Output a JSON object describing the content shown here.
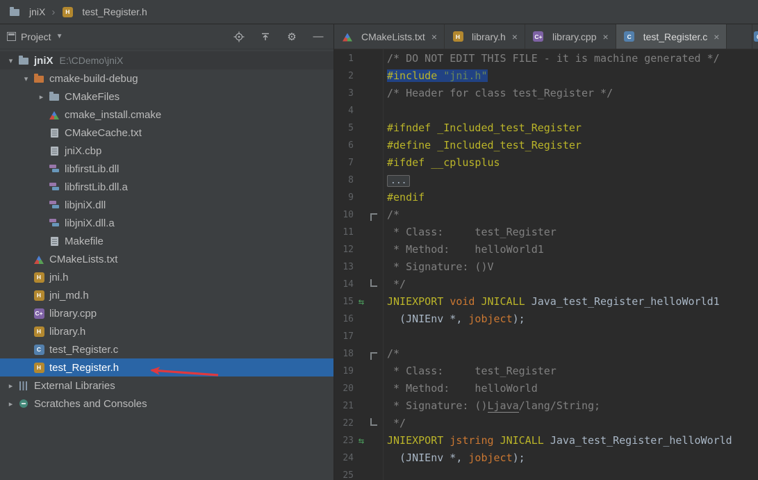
{
  "breadcrumb": {
    "root": "jniX",
    "file": "test_Register.h"
  },
  "project_panel": {
    "title": "Project",
    "toolbar_icons": [
      "locate",
      "collapse-all",
      "settings",
      "hide-panel"
    ],
    "tree": [
      {
        "label": "jniX",
        "suffix": "E:\\CDemo\\jniX",
        "level": 0,
        "icon": "folder",
        "arrow": "down",
        "bold": true,
        "root": true
      },
      {
        "label": "cmake-build-debug",
        "level": 1,
        "icon": "folder-excluded",
        "arrow": "down"
      },
      {
        "label": "CMakeFiles",
        "level": 2,
        "icon": "folder",
        "arrow": "right"
      },
      {
        "label": "cmake_install.cmake",
        "level": 2,
        "icon": "cmake"
      },
      {
        "label": "CMakeCache.txt",
        "level": 2,
        "icon": "doc"
      },
      {
        "label": "jniX.cbp",
        "level": 2,
        "icon": "doc"
      },
      {
        "label": "libfirstLib.dll",
        "level": 2,
        "icon": "lib"
      },
      {
        "label": "libfirstLib.dll.a",
        "level": 2,
        "icon": "lib"
      },
      {
        "label": "libjniX.dll",
        "level": 2,
        "icon": "lib"
      },
      {
        "label": "libjniX.dll.a",
        "level": 2,
        "icon": "lib"
      },
      {
        "label": "Makefile",
        "level": 2,
        "icon": "doc"
      },
      {
        "label": "CMakeLists.txt",
        "level": 1,
        "icon": "cmake"
      },
      {
        "label": "jni.h",
        "level": 1,
        "icon": "h"
      },
      {
        "label": "jni_md.h",
        "level": 1,
        "icon": "h"
      },
      {
        "label": "library.cpp",
        "level": 1,
        "icon": "cpp"
      },
      {
        "label": "library.h",
        "level": 1,
        "icon": "h"
      },
      {
        "label": "test_Register.c",
        "level": 1,
        "icon": "c"
      },
      {
        "label": "test_Register.h",
        "level": 1,
        "icon": "h",
        "selected": true
      },
      {
        "label": "External Libraries",
        "level": 0,
        "icon": "extlib",
        "arrow": "right"
      },
      {
        "label": "Scratches and Consoles",
        "level": 0,
        "icon": "scratch",
        "arrow": "right"
      }
    ]
  },
  "editor": {
    "tabs": [
      {
        "label": "CMakeLists.txt",
        "icon": "cmake",
        "active": false
      },
      {
        "label": "library.h",
        "icon": "h",
        "active": false
      },
      {
        "label": "library.cpp",
        "icon": "cpp",
        "active": false
      },
      {
        "label": "test_Register.c",
        "icon": "c",
        "active": true
      }
    ],
    "lines": [
      {
        "num": 1,
        "tokens": [
          {
            "t": "/* DO NOT EDIT THIS FILE - it is machine generated */",
            "c": "cm"
          }
        ]
      },
      {
        "num": 2,
        "selected": true,
        "tokens": [
          {
            "t": "#include ",
            "c": "pp"
          },
          {
            "t": "\"jni.h\"",
            "c": "str"
          }
        ]
      },
      {
        "num": 3,
        "tokens": [
          {
            "t": "/* Header for class test_Register */",
            "c": "cm"
          }
        ]
      },
      {
        "num": 4,
        "tokens": []
      },
      {
        "num": 5,
        "tokens": [
          {
            "t": "#ifndef _Included_test_Register",
            "c": "pp"
          }
        ]
      },
      {
        "num": 6,
        "tokens": [
          {
            "t": "#define _Included_test_Register",
            "c": "pp"
          }
        ]
      },
      {
        "num": 7,
        "tokens": [
          {
            "t": "#ifdef __cplusplus",
            "c": "pp"
          }
        ]
      },
      {
        "num": 8,
        "tokens": [
          {
            "t": "...",
            "c": "fold"
          }
        ]
      },
      {
        "num": 9,
        "tokens": [
          {
            "t": "#endif",
            "c": "pp"
          }
        ]
      },
      {
        "num": 10,
        "fold": "open",
        "tokens": [
          {
            "t": "/*",
            "c": "cm"
          }
        ]
      },
      {
        "num": 11,
        "tokens": [
          {
            "t": " * Class:     test_Register",
            "c": "cm"
          }
        ]
      },
      {
        "num": 12,
        "tokens": [
          {
            "t": " * Method:    helloWorld1",
            "c": "cm"
          }
        ]
      },
      {
        "num": 13,
        "tokens": [
          {
            "t": " * Signature: ()V",
            "c": "cm"
          }
        ]
      },
      {
        "num": 14,
        "fold": "close",
        "tokens": [
          {
            "t": " */",
            "c": "cm"
          }
        ]
      },
      {
        "num": 15,
        "gutter": "impl",
        "tokens": [
          {
            "t": "JNIEXPORT ",
            "c": "pp"
          },
          {
            "t": "void ",
            "c": "kw"
          },
          {
            "t": "JNICALL ",
            "c": "pp"
          },
          {
            "t": "Java_test_Register_helloWorld1",
            "c": "fn"
          }
        ]
      },
      {
        "num": 16,
        "tokens": [
          {
            "t": "  (JNIEnv *, ",
            "c": "pl"
          },
          {
            "t": "jobject",
            "c": "kw"
          },
          {
            "t": ");",
            "c": "pl"
          }
        ]
      },
      {
        "num": 17,
        "tokens": []
      },
      {
        "num": 18,
        "fold": "open",
        "tokens": [
          {
            "t": "/*",
            "c": "cm"
          }
        ]
      },
      {
        "num": 19,
        "tokens": [
          {
            "t": " * Class:     test_Register",
            "c": "cm"
          }
        ]
      },
      {
        "num": 20,
        "tokens": [
          {
            "t": " * Method:    helloWorld",
            "c": "cm"
          }
        ]
      },
      {
        "num": 21,
        "tokens": [
          {
            "t": " * Signature: ()",
            "c": "cm"
          },
          {
            "t": "Ljava",
            "c": "cm u"
          },
          {
            "t": "/lang/String;",
            "c": "cm"
          }
        ]
      },
      {
        "num": 22,
        "fold": "close",
        "tokens": [
          {
            "t": " */",
            "c": "cm"
          }
        ]
      },
      {
        "num": 23,
        "gutter": "impl",
        "tokens": [
          {
            "t": "JNIEXPORT ",
            "c": "pp"
          },
          {
            "t": "jstring ",
            "c": "kw"
          },
          {
            "t": "JNICALL ",
            "c": "pp"
          },
          {
            "t": "Java_test_Register_helloWorld",
            "c": "fn"
          }
        ]
      },
      {
        "num": 24,
        "tokens": [
          {
            "t": "  (JNIEnv *, ",
            "c": "pl"
          },
          {
            "t": "jobject",
            "c": "kw"
          },
          {
            "t": ");",
            "c": "pl"
          }
        ]
      },
      {
        "num": 25,
        "tokens": []
      }
    ]
  },
  "colors": {
    "tree_selection": "#2A65A6",
    "editor_selection": "#214283",
    "annotation": "#E0393E"
  }
}
